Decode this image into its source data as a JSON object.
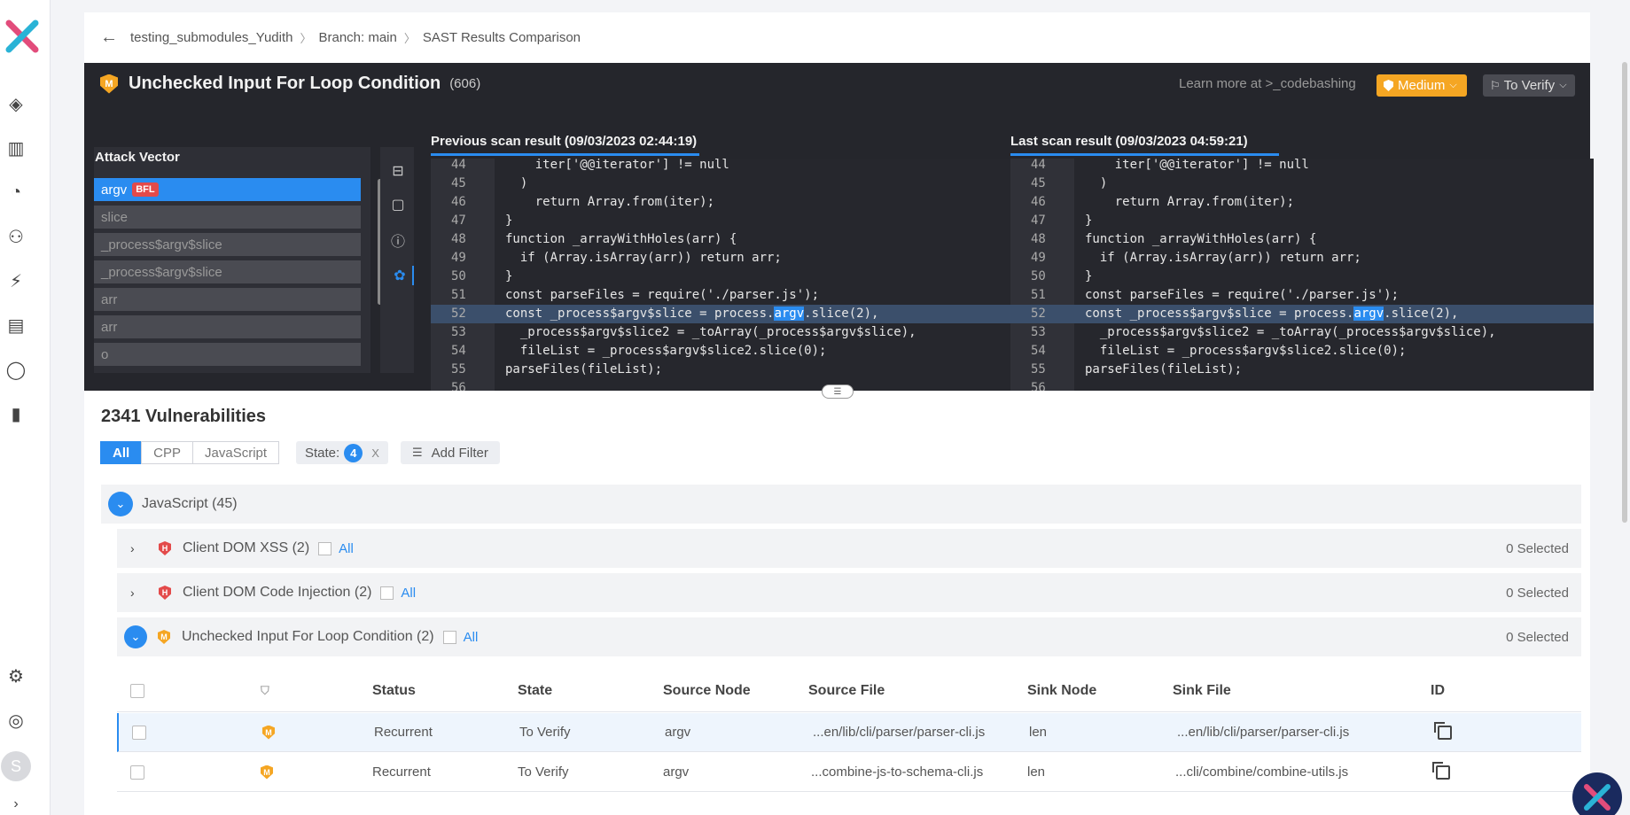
{
  "breadcrumb": [
    "testing_submodules_Yudith",
    "Branch: main",
    "SAST Results Comparison"
  ],
  "vulnerability": {
    "severity_letter": "M",
    "title": "Unchecked Input For Loop Condition",
    "count": "(606)",
    "learn_more": "Learn more at >_codebashing",
    "severity_label": "Medium",
    "state_label": "To Verify"
  },
  "attack_vector": {
    "heading": "Attack Vector",
    "items": [
      "argv",
      "slice",
      "_process$argv$slice",
      "_process$argv$slice",
      "arr",
      "arr",
      "o"
    ],
    "badge": "BFL"
  },
  "previous_scan": {
    "title": "Previous scan result (09/03/2023 02:44:19)",
    "lines": [
      {
        "n": "44",
        "code": "    iter['@@iterator'] != null"
      },
      {
        "n": "45",
        "code": "  )"
      },
      {
        "n": "46",
        "code": "    return Array.from(iter);"
      },
      {
        "n": "47",
        "code": "}"
      },
      {
        "n": "48",
        "code": "function _arrayWithHoles(arr) {"
      },
      {
        "n": "49",
        "code": "  if (Array.isArray(arr)) return arr;"
      },
      {
        "n": "50",
        "code": "}"
      },
      {
        "n": "51",
        "code": "const parseFiles = require('./parser.js');"
      },
      {
        "n": "52",
        "pre": "const _process$argv$slice = process.",
        "token": "argv",
        "post": ".slice(2),"
      },
      {
        "n": "53",
        "code": "  _process$argv$slice2 = _toArray(_process$argv$slice),"
      },
      {
        "n": "54",
        "code": "  fileList = _process$argv$slice2.slice(0);"
      },
      {
        "n": "55",
        "code": "parseFiles(fileList);"
      },
      {
        "n": "56",
        "code": ""
      }
    ]
  },
  "last_scan": {
    "title": "Last scan result (09/03/2023 04:59:21)",
    "lines": [
      {
        "n": "44",
        "code": "    iter['@@iterator'] != null"
      },
      {
        "n": "45",
        "code": "  )"
      },
      {
        "n": "46",
        "code": "    return Array.from(iter);"
      },
      {
        "n": "47",
        "code": "}"
      },
      {
        "n": "48",
        "code": "function _arrayWithHoles(arr) {"
      },
      {
        "n": "49",
        "code": "  if (Array.isArray(arr)) return arr;"
      },
      {
        "n": "50",
        "code": "}"
      },
      {
        "n": "51",
        "code": "const parseFiles = require('./parser.js');"
      },
      {
        "n": "52",
        "pre": "const _process$argv$slice = process.",
        "token": "argv",
        "post": ".slice(2),"
      },
      {
        "n": "53",
        "code": "  _process$argv$slice2 = _toArray(_process$argv$slice),"
      },
      {
        "n": "54",
        "code": "  fileList = _process$argv$slice2.slice(0);"
      },
      {
        "n": "55",
        "code": "parseFiles(fileList);"
      },
      {
        "n": "56",
        "code": ""
      }
    ]
  },
  "results": {
    "title": "2341 Vulnerabilities",
    "tabs": [
      "All",
      "CPP",
      "JavaScript"
    ],
    "state_filter_label": "State:",
    "state_filter_count": "4",
    "state_filter_close": "X",
    "add_filter": "Add Filter",
    "language_group": "JavaScript (45)",
    "groups": [
      {
        "severity": "H",
        "name": "Client DOM XSS (2)",
        "all": "All",
        "selected": "0 Selected"
      },
      {
        "severity": "H",
        "name": "Client DOM Code Injection (2)",
        "all": "All",
        "selected": "0 Selected"
      },
      {
        "severity": "M",
        "name": "Unchecked Input For Loop Condition (2)",
        "all": "All",
        "selected": "0 Selected"
      }
    ],
    "columns": [
      "Status",
      "State",
      "Source Node",
      "Source File",
      "Sink Node",
      "Sink File",
      "ID"
    ],
    "rows": [
      {
        "severity": "M",
        "status": "Recurrent",
        "state": "To Verify",
        "source_node": "argv",
        "source_file": "...en/lib/cli/parser/parser-cli.js",
        "sink_node": "len",
        "sink_file": "...en/lib/cli/parser/parser-cli.js"
      },
      {
        "severity": "M",
        "status": "Recurrent",
        "state": "To Verify",
        "source_node": "argv",
        "source_file": "...combine-js-to-schema-cli.js",
        "sink_node": "len",
        "sink_file": "...cli/combine/combine-utils.js"
      }
    ]
  },
  "user_initial": "S",
  "colors": {
    "accent": "#2a8cf0",
    "high": "#e34a4a",
    "medium": "#f5a623",
    "dark": "#25262c"
  }
}
